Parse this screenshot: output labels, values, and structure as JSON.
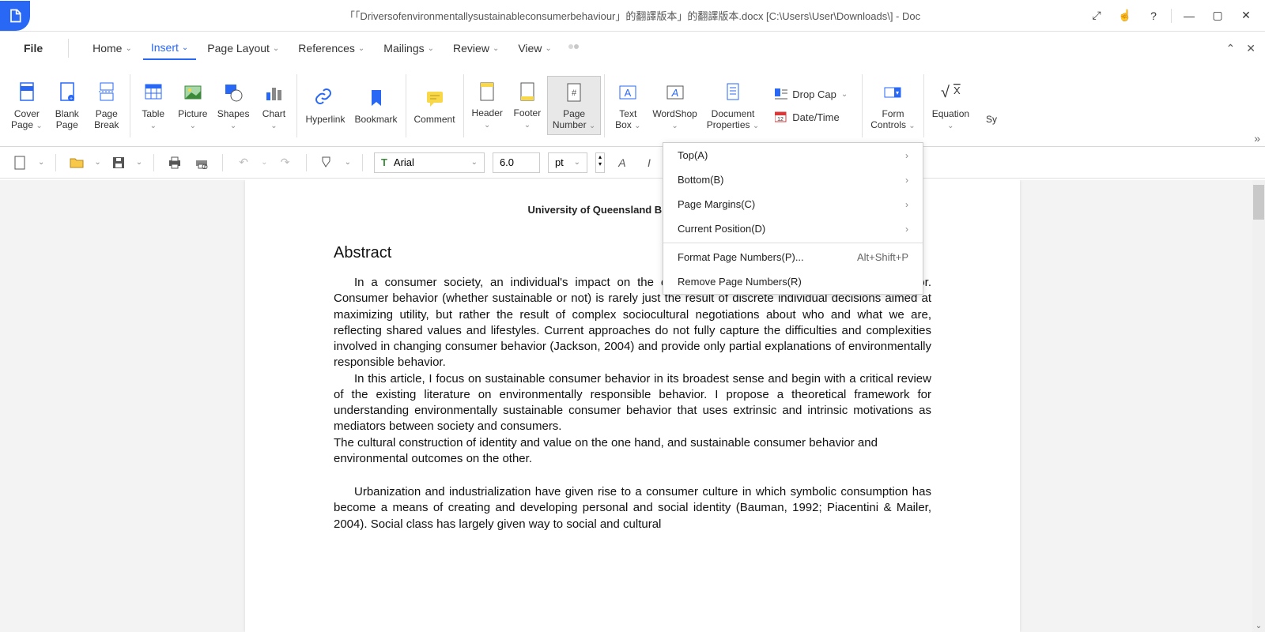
{
  "window_title": "「「Driversofenvironmentallysustainableconsumerbehaviour」的翻譯版本」的翻譯版本.docx [C:\\Users\\User\\Downloads\\] - Doc",
  "menus": {
    "file": "File",
    "home": "Home",
    "insert": "Insert",
    "page_layout": "Page Layout",
    "references": "References",
    "mailings": "Mailings",
    "review": "Review",
    "view": "View"
  },
  "ribbon": {
    "cover_page": "Cover\nPage",
    "blank_page": "Blank\nPage",
    "page_break": "Page\nBreak",
    "table": "Table",
    "picture": "Picture",
    "shapes": "Shapes",
    "chart": "Chart",
    "hyperlink": "Hyperlink",
    "bookmark": "Bookmark",
    "comment": "Comment",
    "header": "Header",
    "footer": "Footer",
    "page_number": "Page\nNumber",
    "text_box": "Text\nBox",
    "wordshop": "WordShop",
    "doc_props": "Document\nProperties",
    "drop_cap": "Drop Cap",
    "date_time": "Date/Time",
    "form_controls": "Form\nControls",
    "equation": "Equation",
    "symbol_prefix": "Sy"
  },
  "page_number_menu": {
    "top": "Top(A)",
    "bottom": "Bottom(B)",
    "margins": "Page Margins(C)",
    "current": "Current Position(D)",
    "format": "Format Page Numbers(P)...",
    "format_shortcut": "Alt+Shift+P",
    "remove": "Remove Page Numbers(R)"
  },
  "toolbar2": {
    "font_name": "Arial",
    "font_size": "6.0",
    "font_unit": "pt"
  },
  "document": {
    "header_text": "University of Queensland Business School",
    "abstract_title": "Abstract",
    "para1": "In a consumer society, an individual's impact on the environment is mediated by consumer behavior. Consumer behavior (whether sustainable or not) is rarely just the result of discrete individual decisions aimed at maximizing utility, but rather the result of complex sociocultural negotiations about who and what we are, reflecting shared values and lifestyles. Current approaches do not fully capture the difficulties and complexities involved in changing consumer behavior (Jackson, 2004) and provide only partial explanations of environmentally responsible behavior.",
    "para2": "In this article, I focus on sustainable consumer behavior in its broadest sense and begin with a critical review of the existing literature on environmentally responsible behavior. I propose a theoretical framework for understanding environmentally sustainable consumer behavior that uses extrinsic and intrinsic motivations as mediators between society and consumers.",
    "para3": "The cultural construction of identity and value on the one hand, and sustainable consumer behavior and environmental outcomes on the other.",
    "para4": "Urbanization and industrialization have given rise to a consumer culture in which symbolic consumption has become a means of creating and developing personal and social identity (Bauman, 1992; Piacentini & Mailer, 2004). Social class has largely given way to social and cultural"
  }
}
